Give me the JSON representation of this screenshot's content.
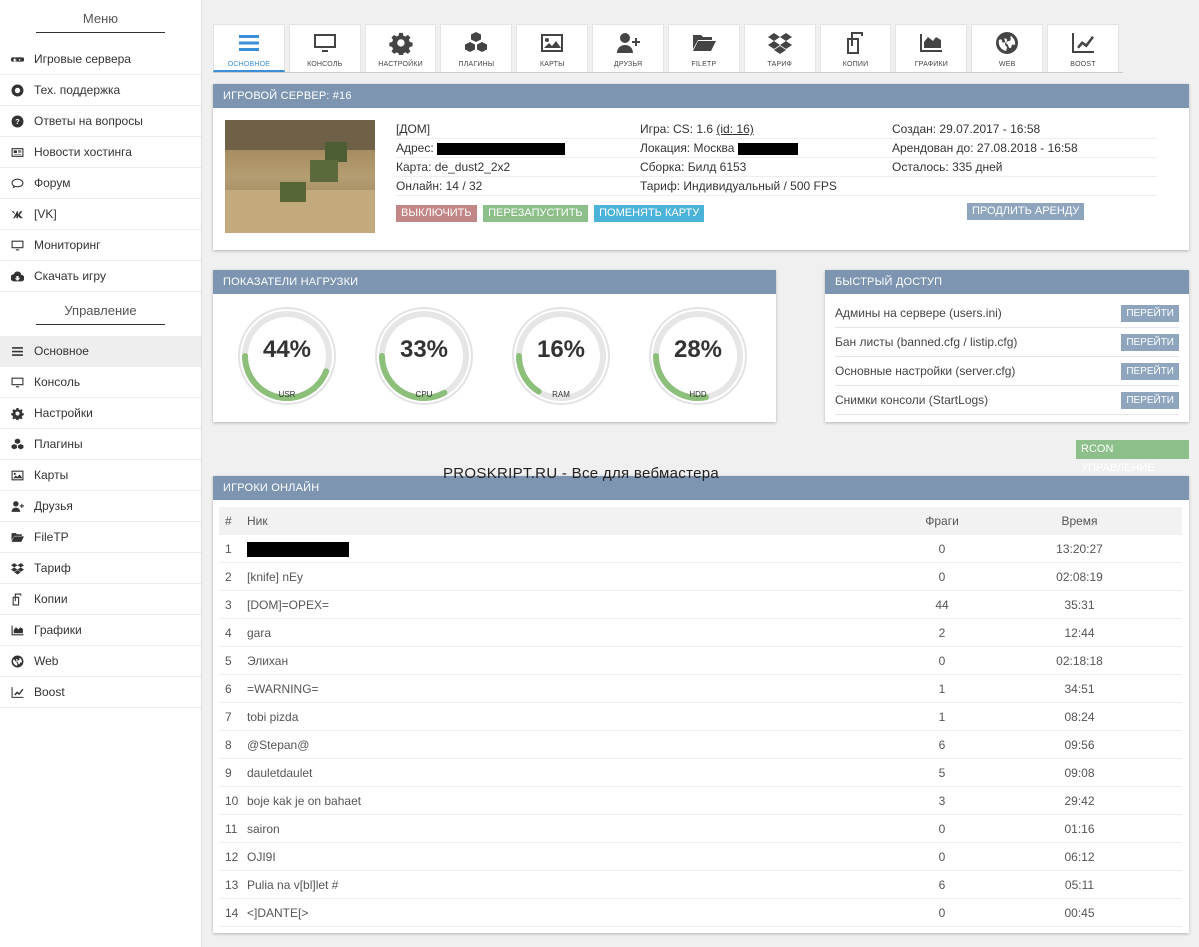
{
  "sidebar": {
    "menu_title": "Меню",
    "menu_items": [
      {
        "label": "Игровые сервера",
        "icon": "gamepad-icon"
      },
      {
        "label": "Тех. поддержка",
        "icon": "lifebuoy-icon"
      },
      {
        "label": "Ответы на вопросы",
        "icon": "question-icon"
      },
      {
        "label": "Новости хостинга",
        "icon": "newspaper-icon"
      },
      {
        "label": "Форум",
        "icon": "comments-icon"
      },
      {
        "label": "[VK]",
        "icon": "vk-icon"
      },
      {
        "label": "Мониторинг",
        "icon": "monitor-icon"
      },
      {
        "label": "Скачать игру",
        "icon": "cloud-download-icon"
      }
    ],
    "manage_title": "Управление",
    "manage_items": [
      {
        "label": "Основное",
        "icon": "bars-icon"
      },
      {
        "label": "Консоль",
        "icon": "monitor-icon"
      },
      {
        "label": "Настройки",
        "icon": "gear-icon"
      },
      {
        "label": "Плагины",
        "icon": "cubes-icon"
      },
      {
        "label": "Карты",
        "icon": "image-icon"
      },
      {
        "label": "Друзья",
        "icon": "user-plus-icon"
      },
      {
        "label": "FileTP",
        "icon": "folder-open-icon"
      },
      {
        "label": "Тариф",
        "icon": "dropbox-icon"
      },
      {
        "label": "Копии",
        "icon": "copy-icon"
      },
      {
        "label": "Графики",
        "icon": "area-chart-icon"
      },
      {
        "label": "Web",
        "icon": "globe-icon"
      },
      {
        "label": "Boost",
        "icon": "line-chart-icon"
      }
    ]
  },
  "toolbar": [
    {
      "label": "ОСНОВНОЕ",
      "icon": "bars-icon"
    },
    {
      "label": "КОНСОЛЬ",
      "icon": "monitor-icon"
    },
    {
      "label": "НАСТРОЙКИ",
      "icon": "gear-icon"
    },
    {
      "label": "ПЛАГИНЫ",
      "icon": "cubes-icon"
    },
    {
      "label": "КАРТЫ",
      "icon": "image-icon"
    },
    {
      "label": "ДРУЗЬЯ",
      "icon": "user-plus-icon"
    },
    {
      "label": "FILETP",
      "icon": "folder-open-icon"
    },
    {
      "label": "ТАРИФ",
      "icon": "dropbox-icon"
    },
    {
      "label": "КОПИИ",
      "icon": "copy-icon"
    },
    {
      "label": "ГРАФИКИ",
      "icon": "area-chart-icon"
    },
    {
      "label": "WEB",
      "icon": "globe-icon"
    },
    {
      "label": "BOOST",
      "icon": "line-chart-icon"
    }
  ],
  "server": {
    "title": "ИГРОВОЙ СЕРВЕР: #16",
    "name": "[ДОМ]",
    "address_label": "Адрес:",
    "map": "Карта: de_dust2_2x2",
    "online": "Онлайн: 14 / 32",
    "game": "Игра: CS: 1.6",
    "game_id": "(id: 16)",
    "location_label": "Локация: Москва",
    "build": "Сборка: Билд 6153",
    "tariff": "Тариф: Индивидуальный / 500 FPS",
    "created": "Создан: 29.07.2017 - 16:58",
    "rented": "Арендован до: 27.08.2018 - 16:58",
    "left": "Осталось: 335 дней",
    "btn_off": "ВЫКЛЮЧИТЬ",
    "btn_restart": "ПЕРЕЗАПУСТИТЬ",
    "btn_map": "ПОМЕНЯТЬ КАРТУ",
    "btn_extend": "ПРОДЛИТЬ АРЕНДУ"
  },
  "load": {
    "title": "ПОКАЗАТЕЛИ НАГРУЗКИ",
    "gauges": [
      {
        "label": "USR",
        "value": "44%",
        "percent": 44
      },
      {
        "label": "CPU",
        "value": "33%",
        "percent": 33
      },
      {
        "label": "RAM",
        "value": "16%",
        "percent": 16
      },
      {
        "label": "HDD",
        "value": "28%",
        "percent": 28
      }
    ]
  },
  "quick": {
    "title": "БЫСТРЫЙ ДОСТУП",
    "items": [
      {
        "label": "Админы на сервере (users.ini)",
        "button": "ПЕРЕЙТИ"
      },
      {
        "label": "Бан листы (banned.cfg / listip.cfg)",
        "button": "ПЕРЕЙТИ"
      },
      {
        "label": "Основные настройки (server.cfg)",
        "button": "ПЕРЕЙТИ"
      },
      {
        "label": "Снимки консоли (StartLogs)",
        "button": "ПЕРЕЙТИ"
      }
    ]
  },
  "rcon_label": "RCON УПРАВЛЕНИЕ",
  "watermark": "PROSKRIPT.RU - Все для вебмастера",
  "players": {
    "title": "ИГРОКИ ОНЛАЙН",
    "columns": [
      "#",
      "Ник",
      "Фраги",
      "Время"
    ],
    "rows": [
      {
        "n": "1",
        "nick": "",
        "frags": "0",
        "time": "13:20:27",
        "redacted": true
      },
      {
        "n": "2",
        "nick": "[knife] nEy",
        "frags": "0",
        "time": "02:08:19"
      },
      {
        "n": "3",
        "nick": "[DOM]=OPEX=",
        "frags": "44",
        "time": "35:31"
      },
      {
        "n": "4",
        "nick": "gara",
        "frags": "2",
        "time": "12:44"
      },
      {
        "n": "5",
        "nick": "Элихан",
        "frags": "0",
        "time": "02:18:18"
      },
      {
        "n": "6",
        "nick": "=WARNING=",
        "frags": "1",
        "time": "34:51"
      },
      {
        "n": "7",
        "nick": "tobi pizda",
        "frags": "1",
        "time": "08:24"
      },
      {
        "n": "8",
        "nick": "@Stepan@",
        "frags": "6",
        "time": "09:56"
      },
      {
        "n": "9",
        "nick": "dauletdaulet",
        "frags": "5",
        "time": "09:08"
      },
      {
        "n": "10",
        "nick": "boje kak je on bahaet",
        "frags": "3",
        "time": "29:42"
      },
      {
        "n": "11",
        "nick": "sairon",
        "frags": "0",
        "time": "01:16"
      },
      {
        "n": "12",
        "nick": "OJI9I",
        "frags": "0",
        "time": "06:12"
      },
      {
        "n": "13",
        "nick": "Pulia na v[bl]let #",
        "frags": "6",
        "time": "05:11"
      },
      {
        "n": "14",
        "nick": "<]DANTE[>",
        "frags": "0",
        "time": "00:45"
      }
    ]
  },
  "colors": {
    "panel_header": "#7d95b0",
    "accent": "#3a8fd9",
    "btn_off": "#c38686",
    "btn_restart": "#8cbf8a",
    "btn_map": "#4cb3d8",
    "btn_extend": "#8ea5bd",
    "gauge": "#8cbf7a"
  }
}
